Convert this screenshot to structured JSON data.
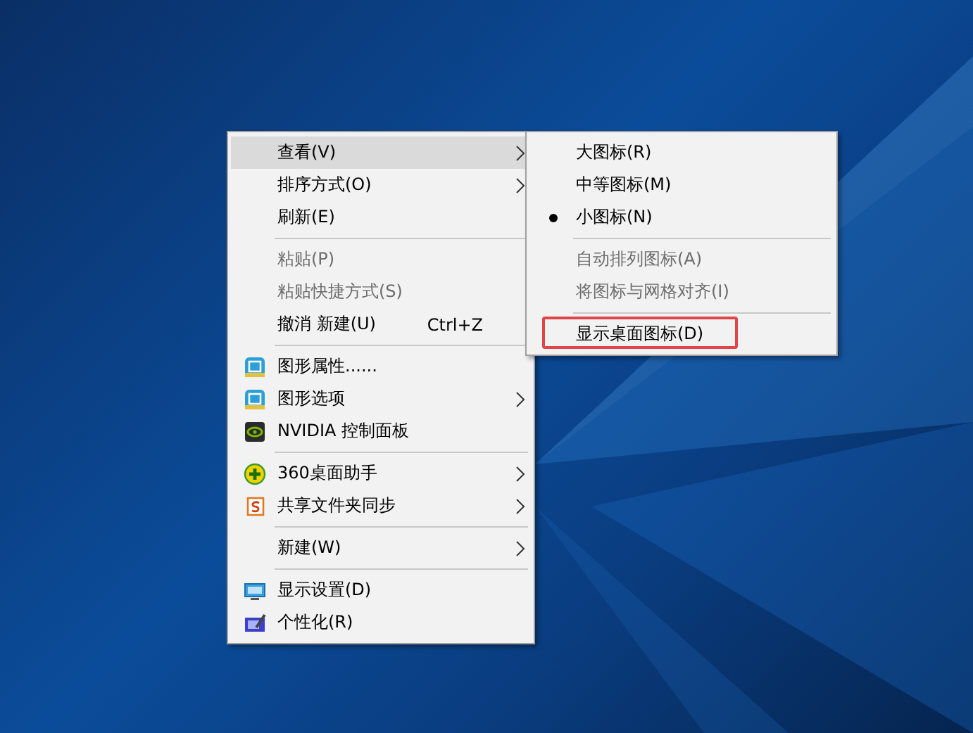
{
  "context_menu": {
    "items": [
      {
        "kind": "item",
        "label": "查看(V)",
        "submenu": true,
        "selected": true,
        "disabled": false
      },
      {
        "kind": "item",
        "label": "排序方式(O)",
        "submenu": true,
        "selected": false,
        "disabled": false
      },
      {
        "kind": "item",
        "label": "刷新(E)",
        "submenu": false,
        "selected": false,
        "disabled": false
      },
      {
        "kind": "separator"
      },
      {
        "kind": "item",
        "label": "粘贴(P)",
        "submenu": false,
        "selected": false,
        "disabled": true
      },
      {
        "kind": "item",
        "label": "粘贴快捷方式(S)",
        "submenu": false,
        "selected": false,
        "disabled": true
      },
      {
        "kind": "item",
        "label": "撤消 新建(U)",
        "shortcut": "Ctrl+Z",
        "submenu": false,
        "selected": false,
        "disabled": false
      },
      {
        "kind": "separator"
      },
      {
        "kind": "icon-item",
        "label": "图形属性......",
        "submenu": false,
        "selected": false,
        "disabled": false
      },
      {
        "kind": "icon-item",
        "label": "图形选项",
        "submenu": true,
        "selected": false,
        "disabled": false
      },
      {
        "kind": "icon-item",
        "label": "NVIDIA 控制面板",
        "submenu": false,
        "selected": false,
        "disabled": false
      },
      {
        "kind": "separator"
      },
      {
        "kind": "icon-item",
        "label": "360桌面助手",
        "submenu": true,
        "selected": false,
        "disabled": false
      },
      {
        "kind": "icon-item",
        "label": "共享文件夹同步",
        "submenu": true,
        "selected": false,
        "disabled": false
      },
      {
        "kind": "separator"
      },
      {
        "kind": "item",
        "label": "新建(W)",
        "submenu": true,
        "selected": false,
        "disabled": false
      },
      {
        "kind": "separator"
      },
      {
        "kind": "icon-item",
        "label": "显示设置(D)",
        "submenu": false,
        "selected": false,
        "disabled": false
      },
      {
        "kind": "icon-item",
        "label": "个性化(R)",
        "submenu": false,
        "selected": false,
        "disabled": false
      }
    ]
  },
  "view_submenu": {
    "items": [
      {
        "kind": "item",
        "label": "大图标(R)",
        "checked": false,
        "disabled": false,
        "highlighted": false
      },
      {
        "kind": "item",
        "label": "中等图标(M)",
        "checked": false,
        "disabled": false,
        "highlighted": false
      },
      {
        "kind": "item",
        "label": "小图标(N)",
        "checked": true,
        "disabled": false,
        "highlighted": false
      },
      {
        "kind": "separator"
      },
      {
        "kind": "item",
        "label": "自动排列图标(A)",
        "checked": false,
        "disabled": true,
        "highlighted": false
      },
      {
        "kind": "item",
        "label": "将图标与网格对齐(I)",
        "checked": false,
        "disabled": true,
        "highlighted": false
      },
      {
        "kind": "separator"
      },
      {
        "kind": "item",
        "label": "显示桌面图标(D)",
        "checked": false,
        "disabled": false,
        "highlighted": true
      }
    ]
  }
}
